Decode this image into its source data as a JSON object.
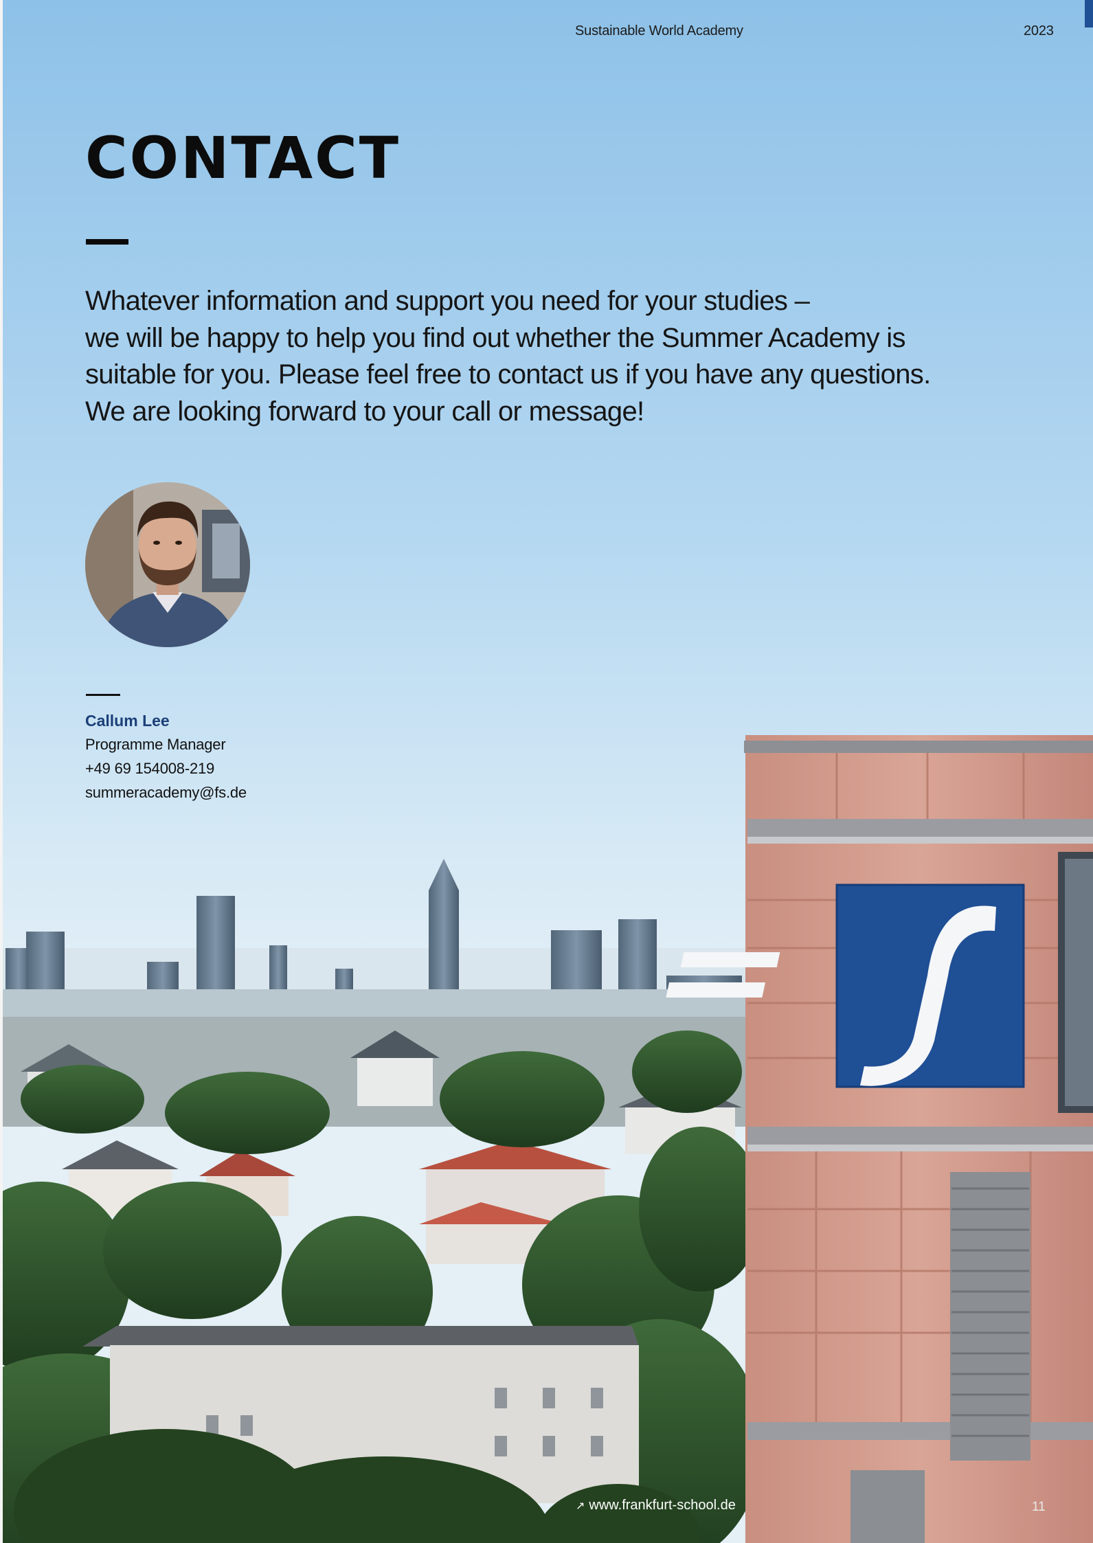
{
  "header": {
    "publication_title": "Sustainable World Academy",
    "year": "2023"
  },
  "main": {
    "title": "CONTACT",
    "intro_lines": [
      "Whatever information and support you need for your studies –",
      "we will be happy to help you find out whether the Summer Academy is",
      "suitable for you. Please feel free to contact us if you have any questions.",
      "We are looking forward to your call or message!"
    ]
  },
  "contact": {
    "name": "Callum Lee",
    "role": "Programme Manager",
    "phone": "+49 69 154008-219",
    "email": "summeracademy@fs.de"
  },
  "footer": {
    "link_icon": "arrow-up-right-icon",
    "link_text": "www.frankfurt-school.de",
    "page_number": "11"
  },
  "colors": {
    "accent": "#1b3f78",
    "brand_blue": "#1f4f95",
    "sky_top": "#8fc2e8",
    "sky_bottom": "#dcecf5"
  },
  "images": {
    "background": "frankfurt-skyline-with-school-building-logo",
    "portrait": "portrait-photo-of-contact-person"
  }
}
